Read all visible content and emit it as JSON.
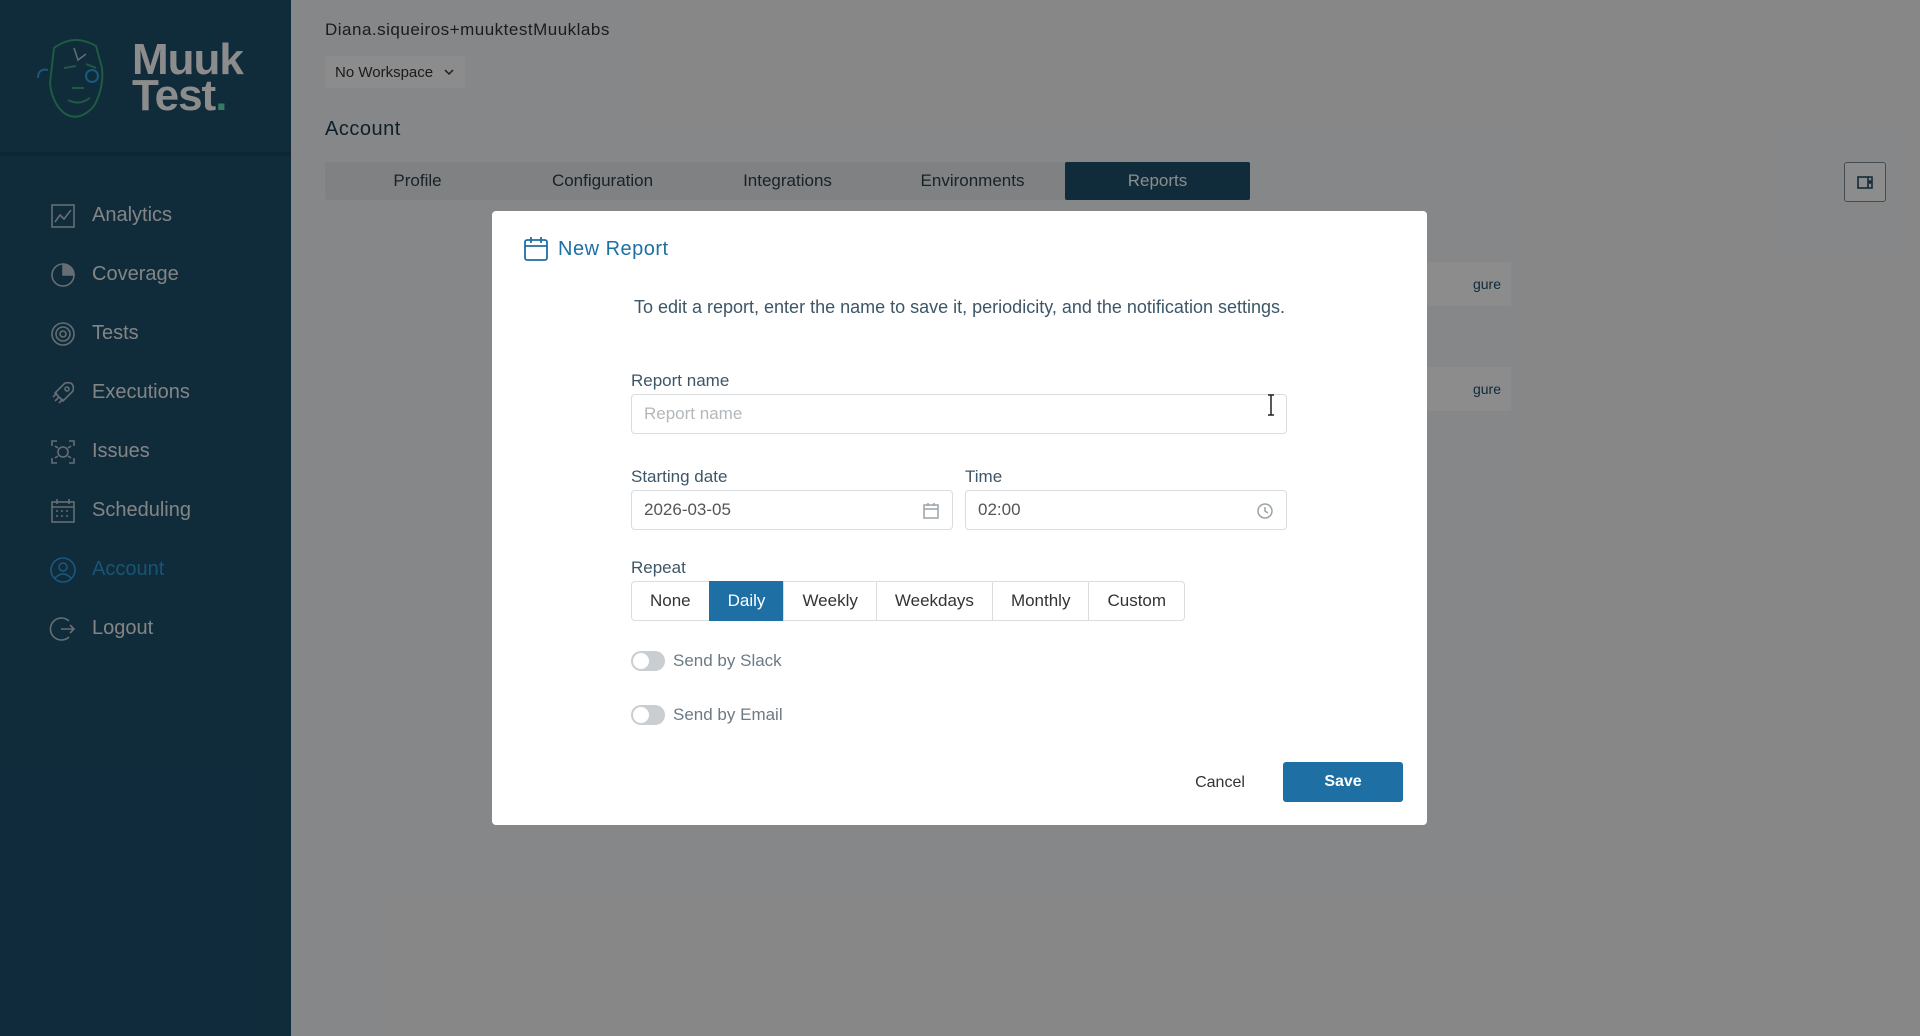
{
  "brand": {
    "line1": "Muuk",
    "line2": "Test",
    "dot": "."
  },
  "sidebar": {
    "items": [
      {
        "label": "Analytics",
        "icon": "analytics-icon"
      },
      {
        "label": "Coverage",
        "icon": "coverage-icon"
      },
      {
        "label": "Tests",
        "icon": "tests-icon"
      },
      {
        "label": "Executions",
        "icon": "executions-icon"
      },
      {
        "label": "Issues",
        "icon": "issues-icon"
      },
      {
        "label": "Scheduling",
        "icon": "scheduling-icon"
      },
      {
        "label": "Account",
        "icon": "account-icon",
        "active": true
      },
      {
        "label": "Logout",
        "icon": "logout-icon"
      }
    ]
  },
  "header": {
    "user": "Diana.siqueiros+muuktestMuuklabs",
    "workspace": "No Workspace",
    "section_title": "Account"
  },
  "tabs": [
    {
      "label": "Profile"
    },
    {
      "label": "Configuration"
    },
    {
      "label": "Integrations"
    },
    {
      "label": "Environments"
    },
    {
      "label": "Reports",
      "active": true
    }
  ],
  "background": {
    "configure_fragment": "gure"
  },
  "modal": {
    "title": "New Report",
    "description": "To edit a report, enter the name to save it, periodicity, and the notification settings.",
    "report_name_label": "Report name",
    "report_name_placeholder": "Report name",
    "starting_date_label": "Starting date",
    "starting_date_value": "2026-03-05",
    "time_label": "Time",
    "time_value": "02:00",
    "repeat_label": "Repeat",
    "repeat_options": [
      "None",
      "Daily",
      "Weekly",
      "Weekdays",
      "Monthly",
      "Custom"
    ],
    "repeat_selected": "Daily",
    "send_slack_label": "Send by Slack",
    "send_email_label": "Send by Email",
    "cancel_label": "Cancel",
    "save_label": "Save"
  },
  "colors": {
    "sidebar_bg": "#1e4f6b",
    "accent": "#1e6fa4",
    "active_nav": "#2ea3e0",
    "logo_dot": "#5fe0b0"
  }
}
